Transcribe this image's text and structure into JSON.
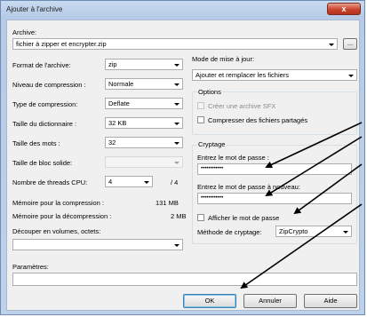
{
  "window": {
    "title": "Ajouter à l'archive",
    "close_glyph": "x"
  },
  "archive": {
    "label": "Archive:",
    "value": "fichier à zipper et encrypter.zip",
    "browse_label": "..."
  },
  "left": {
    "format": {
      "label": "Format de l'archive:",
      "value": "zip"
    },
    "compression": {
      "label": "Niveau de compression :",
      "value": "Normale"
    },
    "type": {
      "label": "Type de compression:",
      "value": "Deflate"
    },
    "dict": {
      "label": "Taille du dictionnaire :",
      "value": "32 KB"
    },
    "words": {
      "label": "Taille des mots :",
      "value": "32"
    },
    "block": {
      "label": "Taille de bloc solide:",
      "value": ""
    },
    "threads": {
      "label": "Nombre de threads CPU:",
      "value": "4",
      "max": "/ 4"
    },
    "mem_comp": {
      "label": "Mémoire pour la compression :",
      "value": "131 MB"
    },
    "mem_decomp": {
      "label": "Mémoire pour la décompression :",
      "value": "2 MB"
    },
    "split": {
      "label": "Découper en volumes, octets:",
      "value": ""
    },
    "params": {
      "label": "Paramètres:",
      "value": ""
    }
  },
  "right": {
    "update": {
      "label": "Mode de mise à jour:",
      "value": "Ajouter et remplacer les fichiers"
    },
    "options": {
      "title": "Options",
      "sfx": "Créer une archive SFX",
      "shared": "Compresser des fichiers partagés"
    },
    "crypto": {
      "title": "Cryptage",
      "pwd_label": "Entrez le mot de passe :",
      "pwd_value": "••••••••••••",
      "pwd2_label": "Entrez le mot de passe à nouveau:",
      "pwd2_value": "••••••••••••",
      "show_label": "Afficher le mot de passe",
      "method_label": "Méthode de cryptage:",
      "method_value": "ZipCrypto"
    }
  },
  "buttons": {
    "ok": "OK",
    "cancel": "Annuler",
    "help": "Aide"
  }
}
